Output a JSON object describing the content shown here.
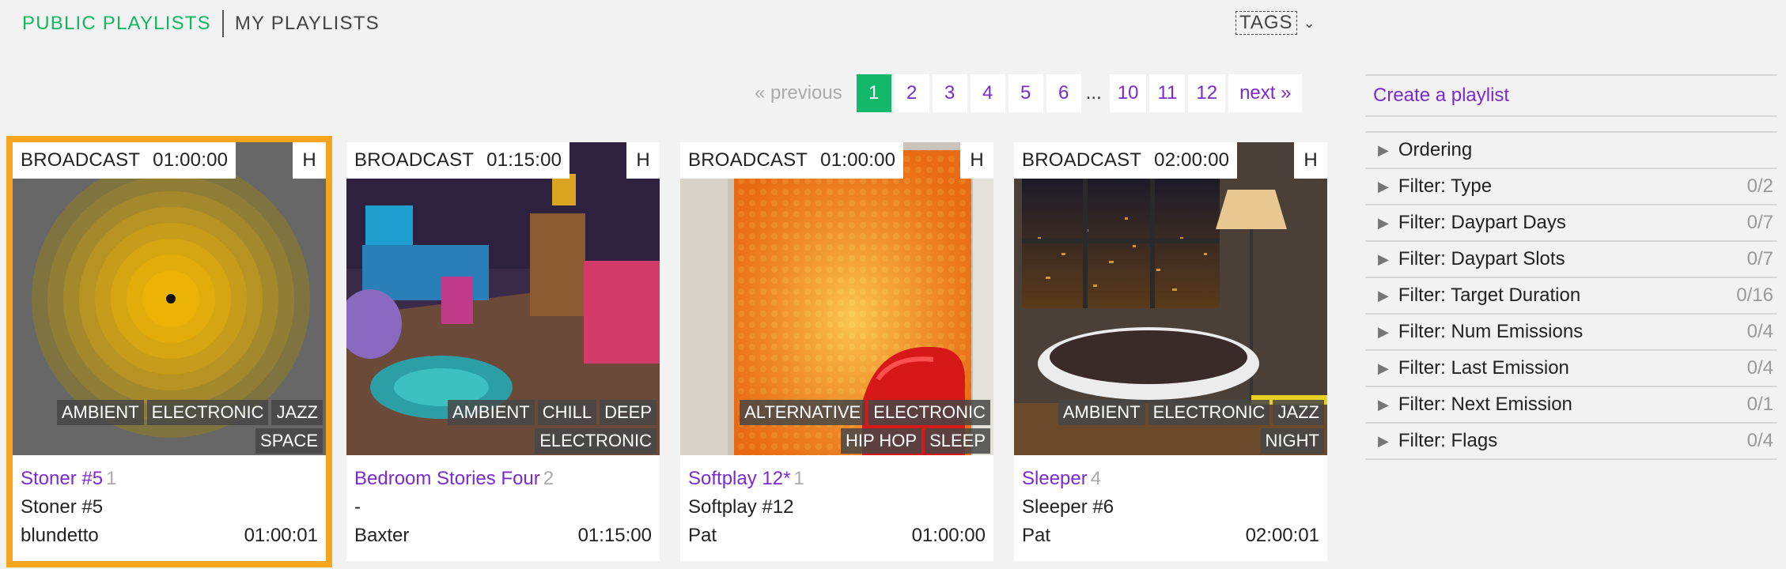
{
  "top_tabs": {
    "public": "PUBLIC PLAYLISTS",
    "mine": "MY PLAYLISTS"
  },
  "tags": {
    "label": "TAGS",
    "icon": "chevron-down-icon"
  },
  "pagination": {
    "previous": "« previous",
    "pages": [
      "1",
      "2",
      "3",
      "4",
      "5",
      "6"
    ],
    "ellipsis": "...",
    "more_pages": [
      "10",
      "11",
      "12"
    ],
    "next": "next »",
    "current": "1"
  },
  "cards": [
    {
      "type": "BROADCAST",
      "duration": "01:00:00",
      "h": "H",
      "tags": [
        "AMBIENT",
        "ELECTRONIC",
        "JAZZ",
        "SPACE"
      ],
      "title": "Stoner #5",
      "count": "1",
      "subtitle": "Stoner #5",
      "author": "blundetto",
      "total": "01:00:01"
    },
    {
      "type": "BROADCAST",
      "duration": "01:15:00",
      "h": "H",
      "tags": [
        "AMBIENT",
        "CHILL",
        "DEEP",
        "ELECTRONIC"
      ],
      "title": "Bedroom Stories Four",
      "count": "2",
      "subtitle": "-",
      "author": "Baxter",
      "total": "01:15:00"
    },
    {
      "type": "BROADCAST",
      "duration": "01:00:00",
      "h": "H",
      "tags": [
        "ALTERNATIVE",
        "ELECTRONIC",
        "HIP HOP",
        "SLEEP"
      ],
      "title": "Softplay 12*",
      "count": "1",
      "subtitle": "Softplay #12",
      "author": "Pat",
      "total": "01:00:00"
    },
    {
      "type": "BROADCAST",
      "duration": "02:00:00",
      "h": "H",
      "tags": [
        "AMBIENT",
        "ELECTRONIC",
        "JAZZ",
        "NIGHT"
      ],
      "title": "Sleeper",
      "count": "4",
      "subtitle": "Sleeper #6",
      "author": "Pat",
      "total": "02:00:01"
    }
  ],
  "sidebar": {
    "create": "Create a playlist",
    "filters": [
      {
        "label": "Ordering",
        "count": ""
      },
      {
        "label": "Filter: Type",
        "count": "0/2"
      },
      {
        "label": "Filter: Daypart Days",
        "count": "0/7"
      },
      {
        "label": "Filter: Daypart Slots",
        "count": "0/7"
      },
      {
        "label": "Filter: Target Duration",
        "count": "0/16"
      },
      {
        "label": "Filter: Num Emissions",
        "count": "0/4"
      },
      {
        "label": "Filter: Last Emission",
        "count": "0/4"
      },
      {
        "label": "Filter: Next Emission",
        "count": "0/1"
      },
      {
        "label": "Filter: Flags",
        "count": "0/4"
      }
    ]
  },
  "colors": {
    "accent_green": "#13b86a",
    "link_purple": "#7b2ad0",
    "selected_outline": "#f7a51c"
  }
}
